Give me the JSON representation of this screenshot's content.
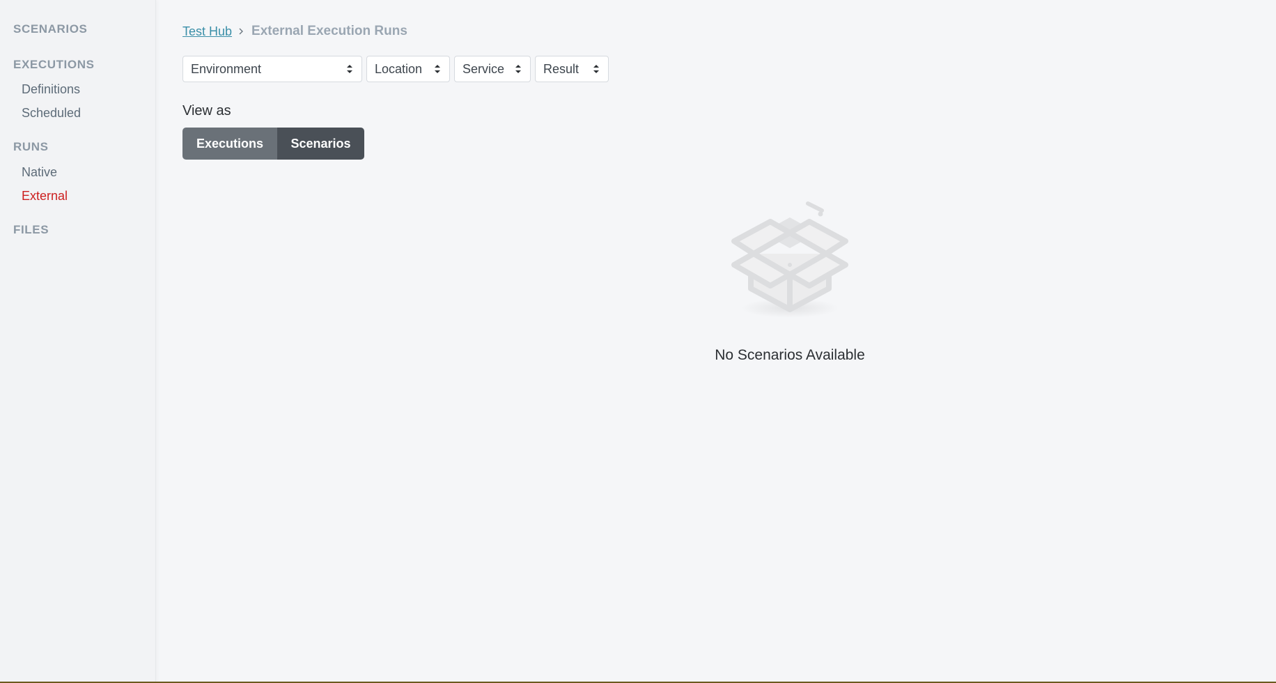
{
  "sidebar": {
    "sections": {
      "scenarios": "SCENARIOS",
      "executions": "EXECUTIONS",
      "runs": "RUNS",
      "files": "FILES"
    },
    "items": {
      "definitions": "Definitions",
      "scheduled": "Scheduled",
      "native": "Native",
      "external": "External"
    },
    "active_item": "External",
    "active_color": "#cc1f1f"
  },
  "breadcrumb": {
    "parent": "Test Hub",
    "current": "External Execution Runs"
  },
  "filters": {
    "environment": "Environment",
    "location": "Location",
    "service": "Service",
    "result": "Result"
  },
  "view_as": {
    "label": "View as",
    "options": [
      "Executions",
      "Scenarios"
    ],
    "selected": "Scenarios"
  },
  "empty_state": {
    "icon": "open-box-icon",
    "message": "No Scenarios Available"
  }
}
